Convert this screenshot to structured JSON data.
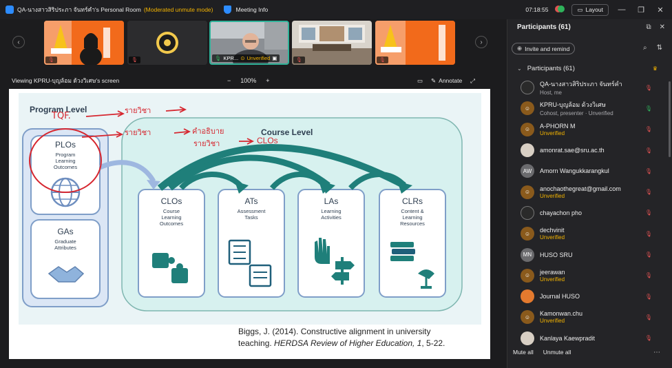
{
  "titlebar": {
    "room_title": "QA-นางสาวสิริประภา จันทร์คำ's Personal Room",
    "mode": "(Moderated unmute mode)",
    "meeting_info": "Meeting Info",
    "clock": "07:18:55",
    "layout": "Layout"
  },
  "strip": {
    "tiles": [
      {
        "label": ""
      },
      {
        "label": ""
      },
      {
        "label": "KPR...",
        "status": "Unverified"
      },
      {
        "label": ""
      },
      {
        "label": ""
      }
    ]
  },
  "viewbar": {
    "viewing": "Viewing KPRU-บุญล้อม ด้วงวิเศษ's screen",
    "zoom_out": "−",
    "zoom": "100%",
    "zoom_in": "+",
    "annotate": "Annotate"
  },
  "slide": {
    "program_level": "Program Level",
    "course_level": "Course Level",
    "plos": {
      "title": "PLOs",
      "sub": [
        "Program",
        "Learning",
        "Outcomes"
      ]
    },
    "gas": {
      "title": "GAs",
      "sub": [
        "Graduate",
        "Attributes"
      ]
    },
    "boxes": [
      {
        "title": "CLOs",
        "sub": [
          "Course",
          "Learning",
          "Outcomes"
        ]
      },
      {
        "title": "ATs",
        "sub": [
          "Assessment",
          "Tasks"
        ]
      },
      {
        "title": "LAs",
        "sub": [
          "Learning",
          "Activities"
        ]
      },
      {
        "title": "CLRs",
        "sub": [
          "Content &",
          "Learning",
          "Resources"
        ]
      }
    ],
    "handwriting": {
      "tqf": "TQF.",
      "line1": "รายวิชา",
      "line2a": "รายวิชา",
      "line2b": "คำอธิบาย",
      "line3": "รายวิชา",
      "clos": "CLOs"
    },
    "citation_line1": "Biggs, J. (2014). Constructive alignment in university",
    "citation_line2_pre": "teaching. ",
    "citation_journal": "HERDSA Review of Higher Education",
    "citation_vol": ", 1",
    "citation_pages": ", 5-22."
  },
  "panel": {
    "title": "Participants (61)",
    "invite": "Invite and remind",
    "group": "Participants (61)",
    "participants": [
      {
        "initials": "",
        "name": "QA-นางสาวสิริประภา จันทร์คำ",
        "sub": "Host, me",
        "avatar": "black"
      },
      {
        "initials": "",
        "name": "KPRU-บุญล้อม ด้วงวิเศษ",
        "sub": "Cohost, presenter · Unverified",
        "avatar": "brown",
        "mic_on": true
      },
      {
        "initials": "",
        "name": "A-PHORN M",
        "sub": "Unverified",
        "avatar": "brown"
      },
      {
        "initials": "",
        "name": "amonrat.sae@sru.ac.th",
        "sub": "",
        "avatar": "photo"
      },
      {
        "initials": "AW",
        "name": "Amorn Wangukkarangkul",
        "sub": "",
        "avatar": "gray"
      },
      {
        "initials": "",
        "name": "anochaothegreat@gmail.com",
        "sub": "Unverified",
        "avatar": "brown"
      },
      {
        "initials": "",
        "name": "chayachon pho",
        "sub": "",
        "avatar": "black"
      },
      {
        "initials": "",
        "name": "dechvinit",
        "sub": "Unverified",
        "avatar": "brown"
      },
      {
        "initials": "MN",
        "name": "HUSO SRU",
        "sub": "",
        "avatar": "gray"
      },
      {
        "initials": "",
        "name": "jeerawan",
        "sub": "Unverified",
        "avatar": "brown"
      },
      {
        "initials": "",
        "name": "Journal HUSO",
        "sub": "",
        "avatar": "orange"
      },
      {
        "initials": "",
        "name": "Kamonwan.chu",
        "sub": "Unverified",
        "avatar": "brown"
      },
      {
        "initials": "",
        "name": "Kanlaya Kaewpradit",
        "sub": "",
        "avatar": "photo"
      }
    ],
    "mute_all": "Mute all",
    "unmute_all": "Unmute all"
  },
  "colors": {
    "accent": "#2d8cff",
    "unverified": "#f4b400",
    "muted": "#e05252",
    "active_border": "#2fb39a",
    "annotation": "#d6262f"
  }
}
